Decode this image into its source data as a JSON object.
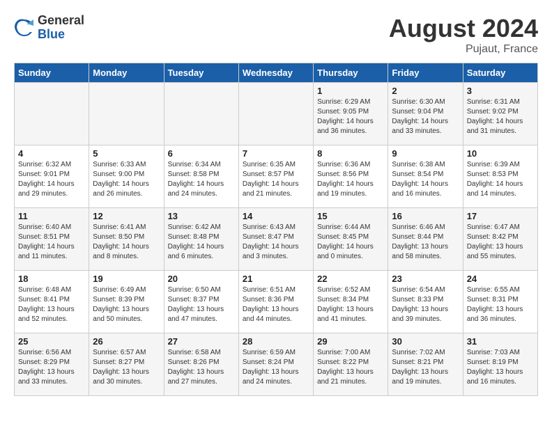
{
  "logo": {
    "general": "General",
    "blue": "Blue"
  },
  "header": {
    "month": "August 2024",
    "location": "Pujaut, France"
  },
  "days_of_week": [
    "Sunday",
    "Monday",
    "Tuesday",
    "Wednesday",
    "Thursday",
    "Friday",
    "Saturday"
  ],
  "weeks": [
    [
      {
        "day": "",
        "info": ""
      },
      {
        "day": "",
        "info": ""
      },
      {
        "day": "",
        "info": ""
      },
      {
        "day": "",
        "info": ""
      },
      {
        "day": "1",
        "info": "Sunrise: 6:29 AM\nSunset: 9:05 PM\nDaylight: 14 hours and 36 minutes."
      },
      {
        "day": "2",
        "info": "Sunrise: 6:30 AM\nSunset: 9:04 PM\nDaylight: 14 hours and 33 minutes."
      },
      {
        "day": "3",
        "info": "Sunrise: 6:31 AM\nSunset: 9:02 PM\nDaylight: 14 hours and 31 minutes."
      }
    ],
    [
      {
        "day": "4",
        "info": "Sunrise: 6:32 AM\nSunset: 9:01 PM\nDaylight: 14 hours and 29 minutes."
      },
      {
        "day": "5",
        "info": "Sunrise: 6:33 AM\nSunset: 9:00 PM\nDaylight: 14 hours and 26 minutes."
      },
      {
        "day": "6",
        "info": "Sunrise: 6:34 AM\nSunset: 8:58 PM\nDaylight: 14 hours and 24 minutes."
      },
      {
        "day": "7",
        "info": "Sunrise: 6:35 AM\nSunset: 8:57 PM\nDaylight: 14 hours and 21 minutes."
      },
      {
        "day": "8",
        "info": "Sunrise: 6:36 AM\nSunset: 8:56 PM\nDaylight: 14 hours and 19 minutes."
      },
      {
        "day": "9",
        "info": "Sunrise: 6:38 AM\nSunset: 8:54 PM\nDaylight: 14 hours and 16 minutes."
      },
      {
        "day": "10",
        "info": "Sunrise: 6:39 AM\nSunset: 8:53 PM\nDaylight: 14 hours and 14 minutes."
      }
    ],
    [
      {
        "day": "11",
        "info": "Sunrise: 6:40 AM\nSunset: 8:51 PM\nDaylight: 14 hours and 11 minutes."
      },
      {
        "day": "12",
        "info": "Sunrise: 6:41 AM\nSunset: 8:50 PM\nDaylight: 14 hours and 8 minutes."
      },
      {
        "day": "13",
        "info": "Sunrise: 6:42 AM\nSunset: 8:48 PM\nDaylight: 14 hours and 6 minutes."
      },
      {
        "day": "14",
        "info": "Sunrise: 6:43 AM\nSunset: 8:47 PM\nDaylight: 14 hours and 3 minutes."
      },
      {
        "day": "15",
        "info": "Sunrise: 6:44 AM\nSunset: 8:45 PM\nDaylight: 14 hours and 0 minutes."
      },
      {
        "day": "16",
        "info": "Sunrise: 6:46 AM\nSunset: 8:44 PM\nDaylight: 13 hours and 58 minutes."
      },
      {
        "day": "17",
        "info": "Sunrise: 6:47 AM\nSunset: 8:42 PM\nDaylight: 13 hours and 55 minutes."
      }
    ],
    [
      {
        "day": "18",
        "info": "Sunrise: 6:48 AM\nSunset: 8:41 PM\nDaylight: 13 hours and 52 minutes."
      },
      {
        "day": "19",
        "info": "Sunrise: 6:49 AM\nSunset: 8:39 PM\nDaylight: 13 hours and 50 minutes."
      },
      {
        "day": "20",
        "info": "Sunrise: 6:50 AM\nSunset: 8:37 PM\nDaylight: 13 hours and 47 minutes."
      },
      {
        "day": "21",
        "info": "Sunrise: 6:51 AM\nSunset: 8:36 PM\nDaylight: 13 hours and 44 minutes."
      },
      {
        "day": "22",
        "info": "Sunrise: 6:52 AM\nSunset: 8:34 PM\nDaylight: 13 hours and 41 minutes."
      },
      {
        "day": "23",
        "info": "Sunrise: 6:54 AM\nSunset: 8:33 PM\nDaylight: 13 hours and 39 minutes."
      },
      {
        "day": "24",
        "info": "Sunrise: 6:55 AM\nSunset: 8:31 PM\nDaylight: 13 hours and 36 minutes."
      }
    ],
    [
      {
        "day": "25",
        "info": "Sunrise: 6:56 AM\nSunset: 8:29 PM\nDaylight: 13 hours and 33 minutes."
      },
      {
        "day": "26",
        "info": "Sunrise: 6:57 AM\nSunset: 8:27 PM\nDaylight: 13 hours and 30 minutes."
      },
      {
        "day": "27",
        "info": "Sunrise: 6:58 AM\nSunset: 8:26 PM\nDaylight: 13 hours and 27 minutes."
      },
      {
        "day": "28",
        "info": "Sunrise: 6:59 AM\nSunset: 8:24 PM\nDaylight: 13 hours and 24 minutes."
      },
      {
        "day": "29",
        "info": "Sunrise: 7:00 AM\nSunset: 8:22 PM\nDaylight: 13 hours and 21 minutes."
      },
      {
        "day": "30",
        "info": "Sunrise: 7:02 AM\nSunset: 8:21 PM\nDaylight: 13 hours and 19 minutes."
      },
      {
        "day": "31",
        "info": "Sunrise: 7:03 AM\nSunset: 8:19 PM\nDaylight: 13 hours and 16 minutes."
      }
    ]
  ]
}
